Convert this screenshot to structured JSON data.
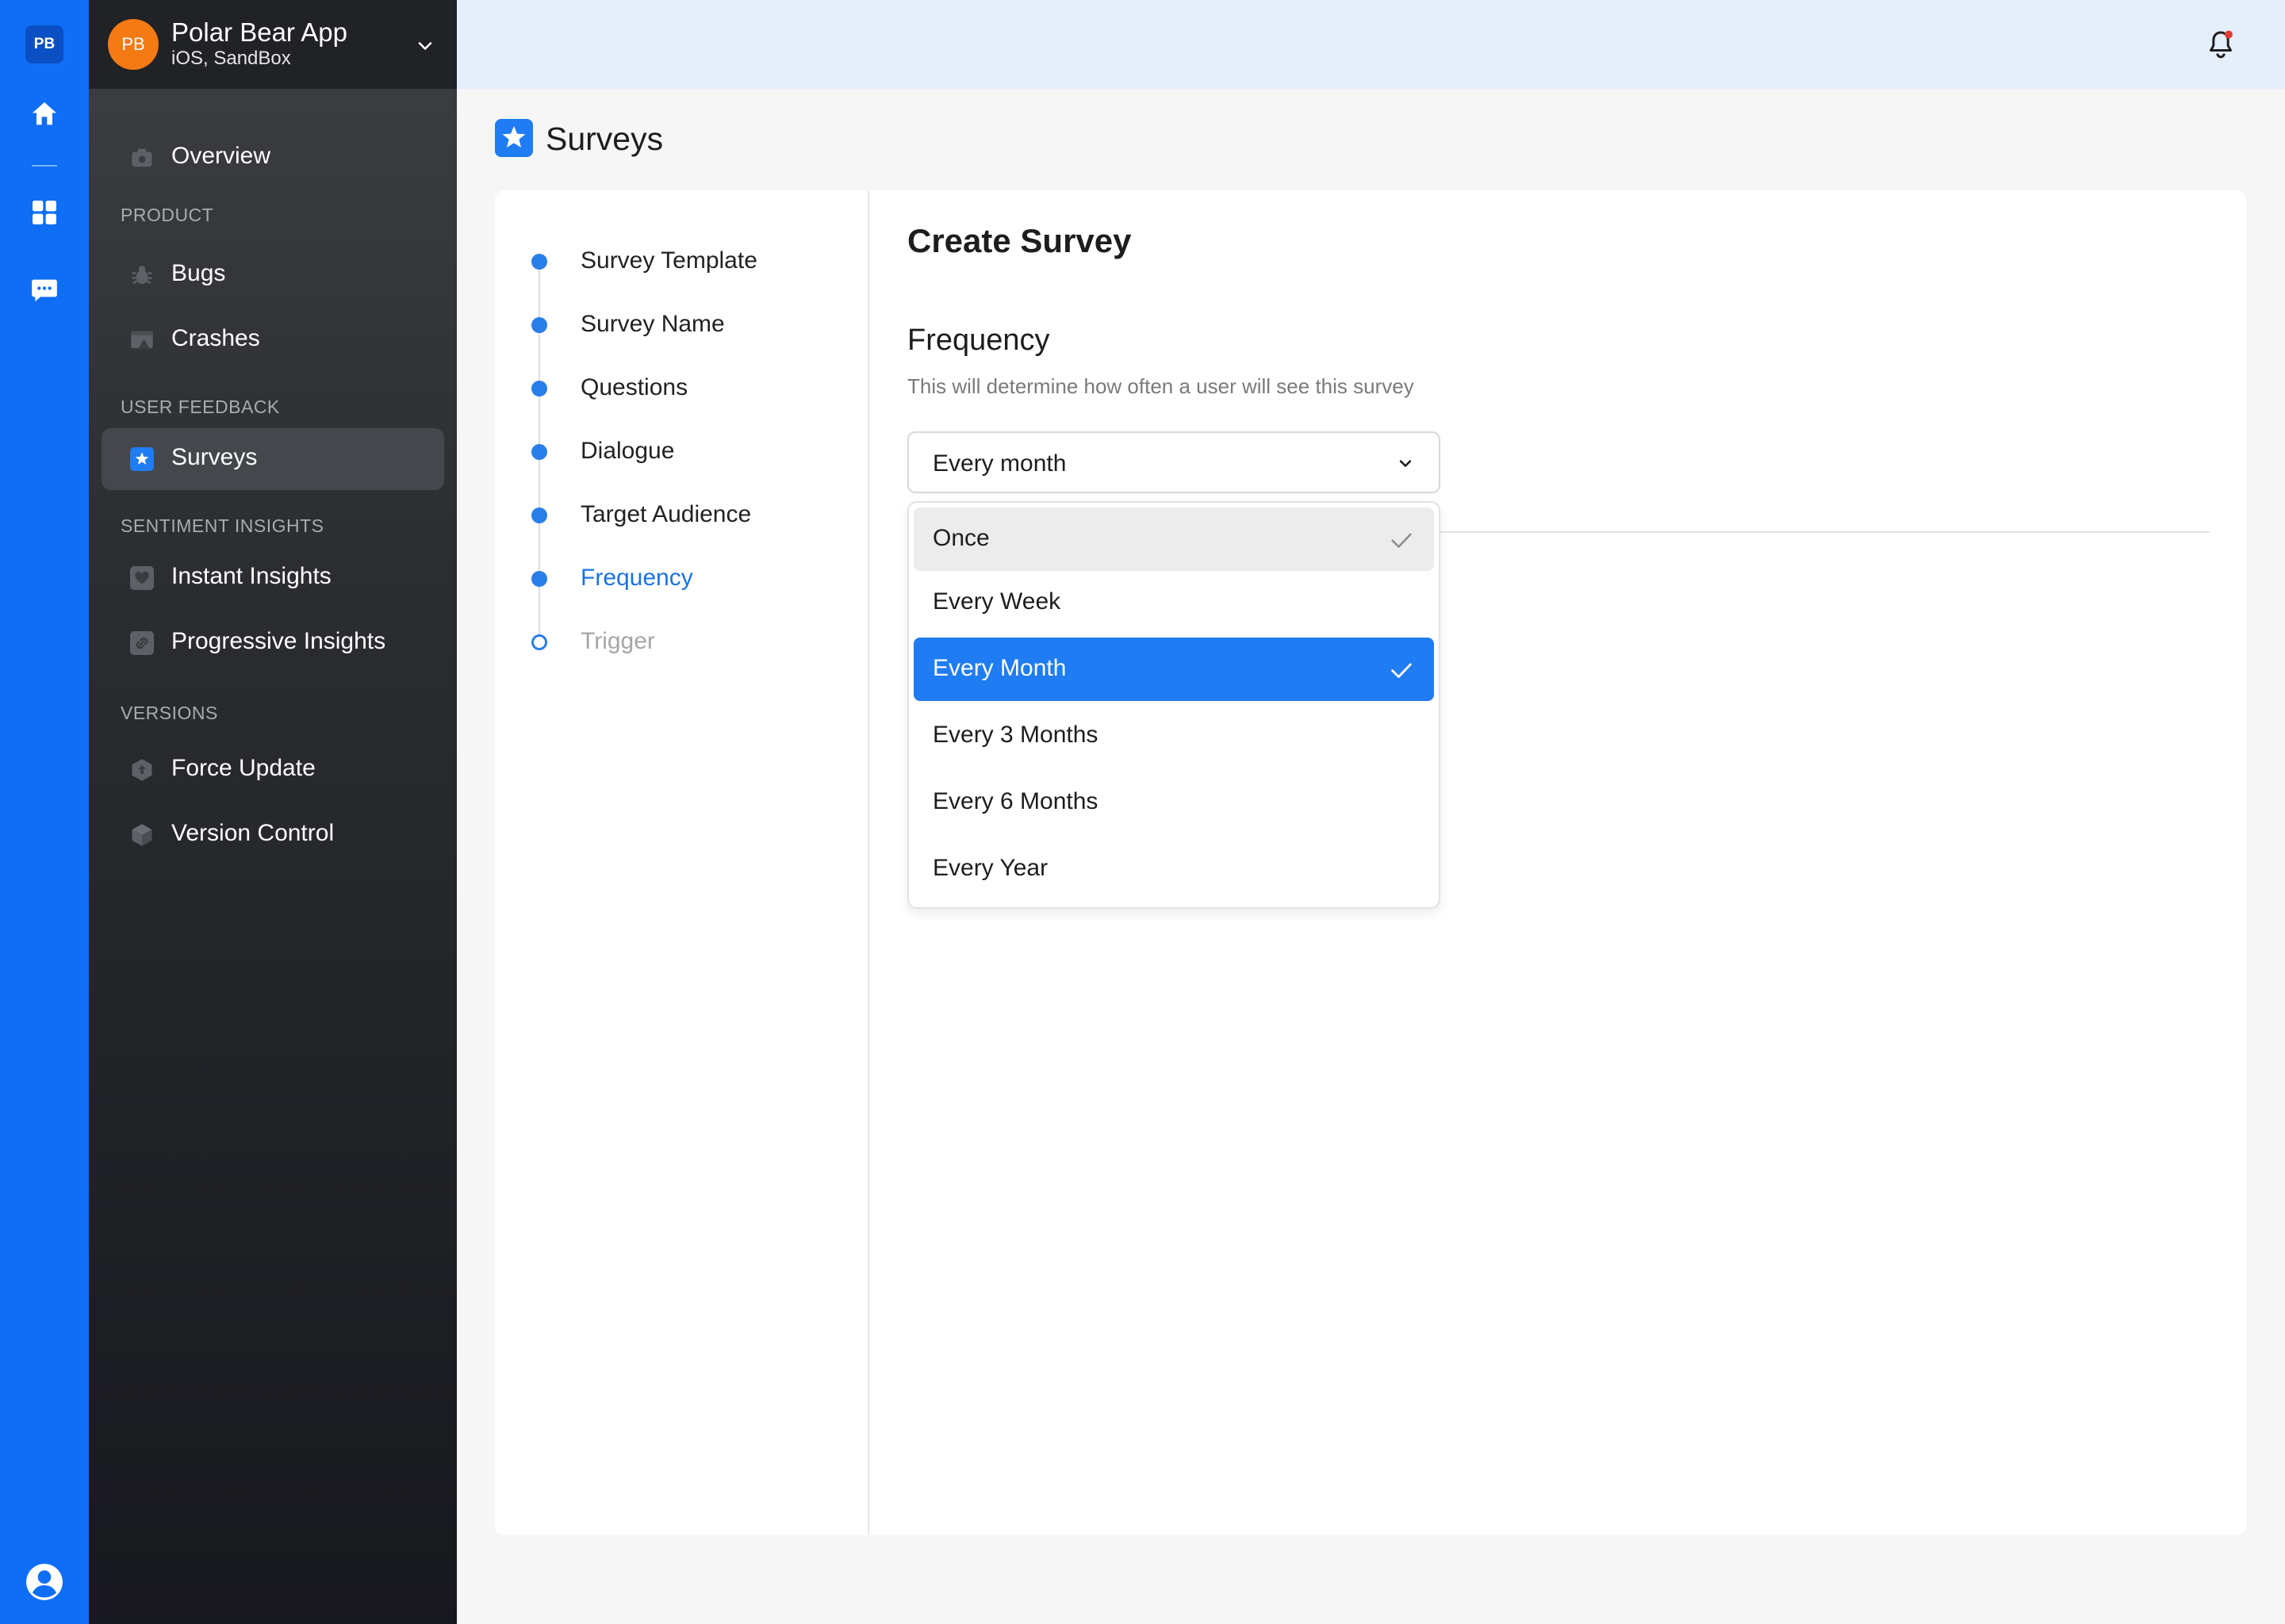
{
  "rail": {
    "logo": "PB"
  },
  "app": {
    "avatar": "PB",
    "name": "Polar Bear App",
    "subtitle": "iOS, SandBox"
  },
  "nav": {
    "overview": "Overview",
    "product_section": "PRODUCT",
    "bugs": "Bugs",
    "crashes": "Crashes",
    "feedback_section": "USER FEEDBACK",
    "surveys": "Surveys",
    "sentiment_section": "SENTIMENT INSIGHTS",
    "instant": "Instant Insights",
    "progressive": "Progressive Insights",
    "versions_section": "VERSIONS",
    "force_update": "Force Update",
    "version_control": "Version Control"
  },
  "page": {
    "title": "Surveys"
  },
  "steps": [
    {
      "label": "Survey Template",
      "state": "done"
    },
    {
      "label": "Survey Name",
      "state": "done"
    },
    {
      "label": "Questions",
      "state": "done"
    },
    {
      "label": "Dialogue",
      "state": "done"
    },
    {
      "label": "Target Audience",
      "state": "done"
    },
    {
      "label": "Frequency",
      "state": "current"
    },
    {
      "label": "Trigger",
      "state": "pending"
    }
  ],
  "form": {
    "heading": "Create Survey",
    "field_title": "Frequency",
    "field_description": "This will determine how often a user will see this survey",
    "selected_value": "Every month"
  },
  "dropdown": {
    "options": [
      "Once",
      "Every Week",
      "Every Month",
      "Every 3 Months",
      "Every 6 Months",
      "Every Year"
    ],
    "hovered": "Once",
    "selected": "Every Month"
  },
  "colors": {
    "accent": "#1f7cf2",
    "rail": "#0f6ef5",
    "avatar": "#f47a14",
    "notification_dot": "#e53935"
  }
}
